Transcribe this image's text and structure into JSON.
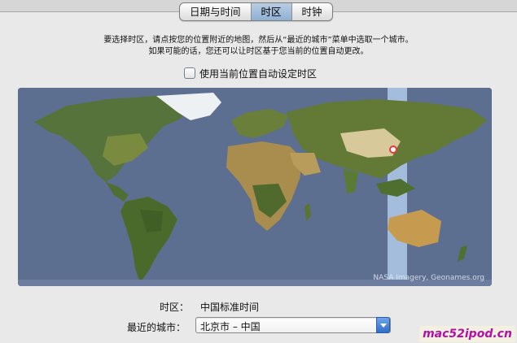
{
  "tabs": [
    {
      "label": "日期与时间",
      "selected": false
    },
    {
      "label": "时区",
      "selected": true
    },
    {
      "label": "时钟",
      "selected": false
    }
  ],
  "description": {
    "line1": "要选择时区，请点按您的位置附近的地图，然后从“最近的城市”菜单中选取一个城市。",
    "line2": "如果可能的话，您还可以让时区基于您当前的位置自动更改。"
  },
  "auto_timezone": {
    "label": "使用当前位置自动设定时区",
    "checked": false
  },
  "map": {
    "credit": "NASA Imagery, Geonames.org",
    "ocean_color": "#5d6f91",
    "highlight_band_color": "#bcd7f5",
    "selected_location_color": "#e53b3b"
  },
  "info": {
    "timezone_label": "时区：",
    "timezone_value": "中国标准时间",
    "city_label": "最近的城市：",
    "city_value": "北京市 – 中国"
  },
  "watermark": "mac52ipod.cn"
}
